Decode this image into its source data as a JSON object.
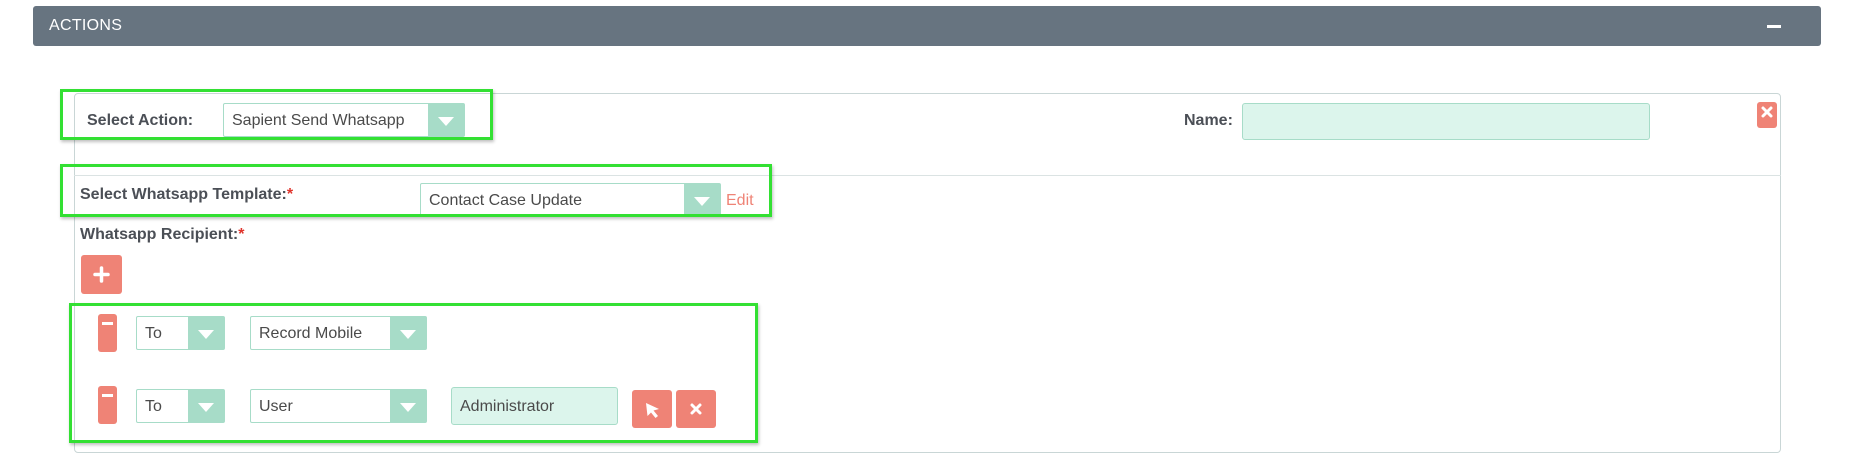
{
  "panel": {
    "title": "ACTIONS",
    "collapse_icon": "minus-icon"
  },
  "action": {
    "select_action_label": "Select Action:",
    "select_action_value": "Sapient Send Whatsapp",
    "name_label": "Name:",
    "name_value": "",
    "remove_icon": "close-icon"
  },
  "template": {
    "label": "Select Whatsapp Template:",
    "required_mark": "*",
    "value": "Contact Case Update",
    "edit_label": "Edit"
  },
  "recipient": {
    "label": "Whatsapp Recipient:",
    "required_mark": "*",
    "add_icon": "plus-icon",
    "rows": [
      {
        "to": "To",
        "type": "Record Mobile"
      },
      {
        "to": "To",
        "type": "User",
        "user": "Administrator"
      }
    ]
  },
  "colors": {
    "header_bg": "#677480",
    "accent": "#ef8376",
    "field_bg": "#dcf5ec",
    "arrow_bg": "#a7dcc8",
    "highlight": "#33e033"
  }
}
